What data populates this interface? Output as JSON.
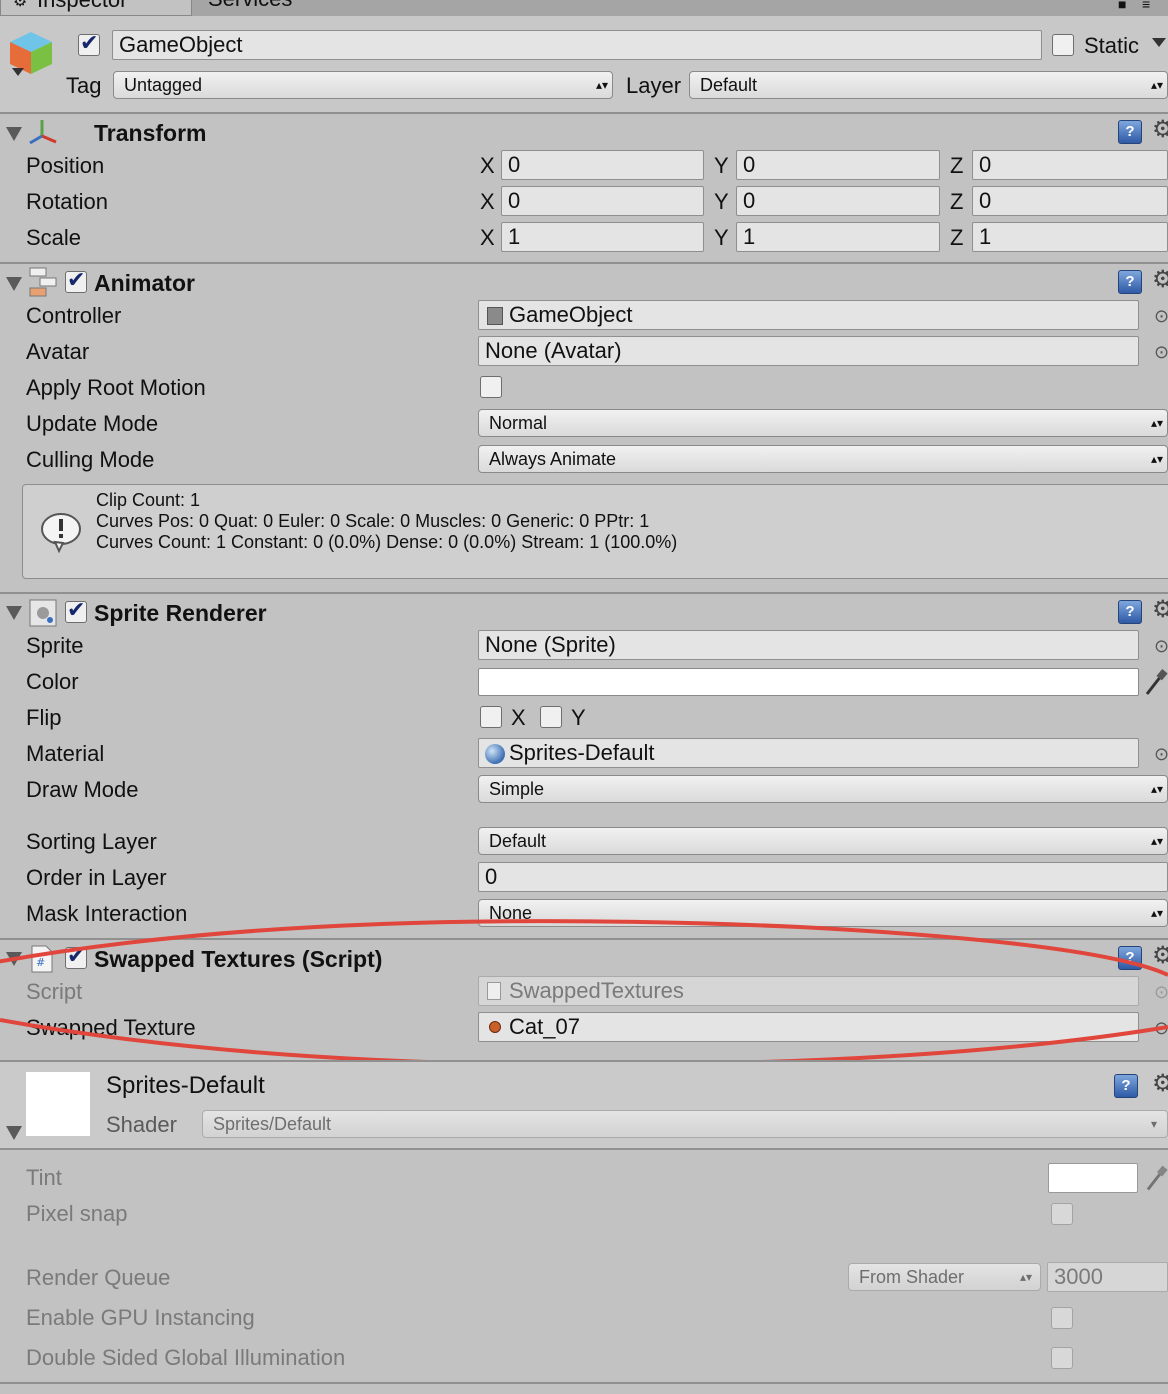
{
  "tabs": [
    {
      "label": "Inspector"
    },
    {
      "label": "Services"
    }
  ],
  "gameobject": {
    "name": "GameObject",
    "active": true,
    "static_label": "Static",
    "tag_label": "Tag",
    "tag_value": "Untagged",
    "layer_label": "Layer",
    "layer_value": "Default"
  },
  "transform": {
    "title": "Transform",
    "rows": [
      {
        "label": "Position",
        "x": "0",
        "y": "0",
        "z": "0"
      },
      {
        "label": "Rotation",
        "x": "0",
        "y": "0",
        "z": "0"
      },
      {
        "label": "Scale",
        "x": "1",
        "y": "1",
        "z": "1"
      }
    ],
    "axis_x": "X",
    "axis_y": "Y",
    "axis_z": "Z"
  },
  "animator": {
    "title": "Animator",
    "controller_label": "Controller",
    "controller_value": "GameObject",
    "avatar_label": "Avatar",
    "avatar_value": "None (Avatar)",
    "root_motion_label": "Apply Root Motion",
    "update_mode_label": "Update Mode",
    "update_mode_value": "Normal",
    "culling_mode_label": "Culling Mode",
    "culling_mode_value": "Always Animate",
    "info_line1": "Clip Count: 1",
    "info_line2": "Curves Pos: 0 Quat: 0 Euler: 0 Scale: 0 Muscles: 0 Generic: 0 PPtr: 1",
    "info_line3": "Curves Count: 1 Constant: 0 (0.0%) Dense: 0 (0.0%) Stream: 1 (100.0%)"
  },
  "sprite_renderer": {
    "title": "Sprite Renderer",
    "sprite_label": "Sprite",
    "sprite_value": "None (Sprite)",
    "color_label": "Color",
    "flip_label": "Flip",
    "flip_x": "X",
    "flip_y": "Y",
    "material_label": "Material",
    "material_value": "Sprites-Default",
    "draw_mode_label": "Draw Mode",
    "draw_mode_value": "Simple",
    "sorting_layer_label": "Sorting Layer",
    "sorting_layer_value": "Default",
    "order_label": "Order in Layer",
    "order_value": "0",
    "mask_label": "Mask Interaction",
    "mask_value": "None"
  },
  "swapped_textures": {
    "title": "Swapped Textures (Script)",
    "script_label": "Script",
    "script_value": "SwappedTextures",
    "texture_label": "Swapped Texture",
    "texture_value": "Cat_07"
  },
  "material": {
    "name": "Sprites-Default",
    "shader_label": "Shader",
    "shader_value": "Sprites/Default",
    "tint_label": "Tint",
    "pixel_snap_label": "Pixel snap",
    "render_queue_label": "Render Queue",
    "render_queue_mode": "From Shader",
    "render_queue_value": "3000",
    "gpu_instancing_label": "Enable GPU Instancing",
    "double_sided_label": "Double Sided Global Illumination"
  },
  "colors": {
    "panel_bg": "#c2c2c2",
    "highlight_ellipse": "#e0463c",
    "help_icon": "#3f6db5"
  }
}
